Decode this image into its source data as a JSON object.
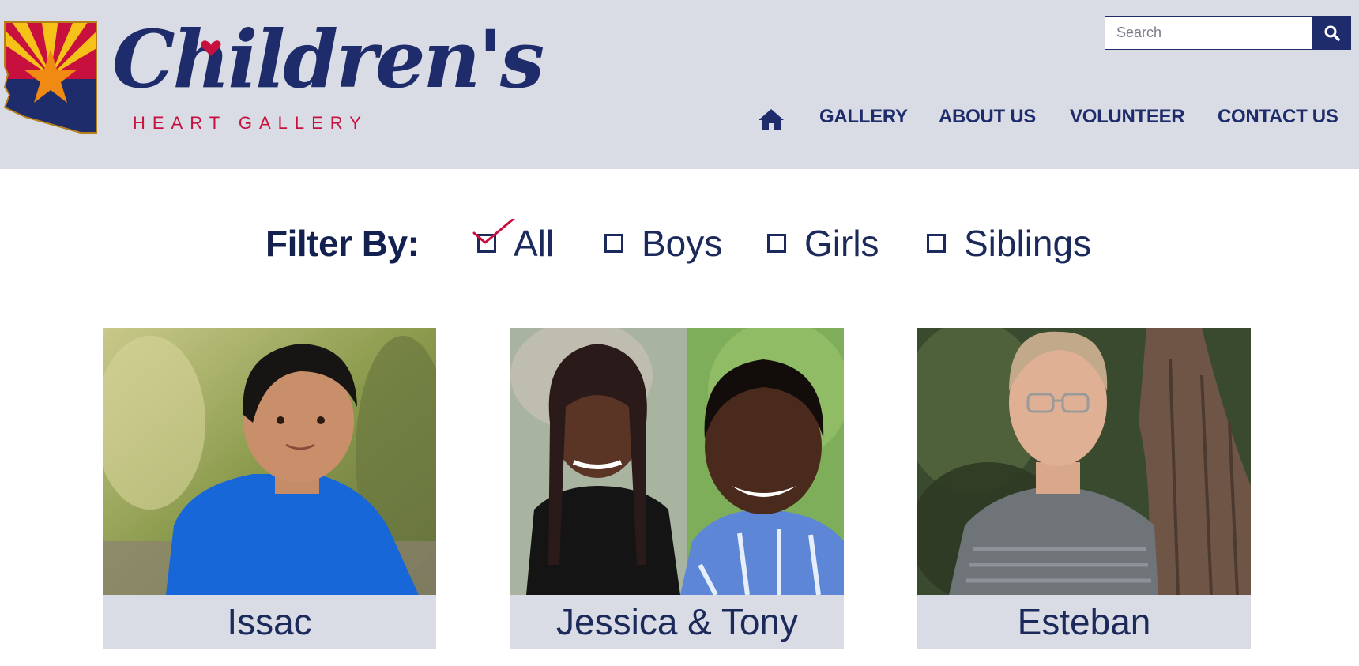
{
  "brand": {
    "title": "Children's",
    "subtitle": "HEART GALLERY",
    "colors": {
      "navy": "#1f2c6b",
      "red": "#c8103e",
      "header_bg": "#d9dce4"
    }
  },
  "search": {
    "placeholder": "Search",
    "value": "",
    "button_icon": "search-icon"
  },
  "nav": {
    "home_icon": "home-icon",
    "items": [
      {
        "label": "GALLERY"
      },
      {
        "label": "ABOUT US"
      },
      {
        "label": "VOLUNTEER"
      },
      {
        "label": "CONTACT US"
      }
    ]
  },
  "filter": {
    "label": "Filter By:",
    "options": [
      {
        "label": "All",
        "checked": true
      },
      {
        "label": "Boys",
        "checked": false
      },
      {
        "label": "Girls",
        "checked": false
      },
      {
        "label": "Siblings",
        "checked": false
      }
    ]
  },
  "gallery": {
    "cards": [
      {
        "name": "Issac"
      },
      {
        "name": "Jessica & Tony"
      },
      {
        "name": "Esteban"
      }
    ]
  }
}
